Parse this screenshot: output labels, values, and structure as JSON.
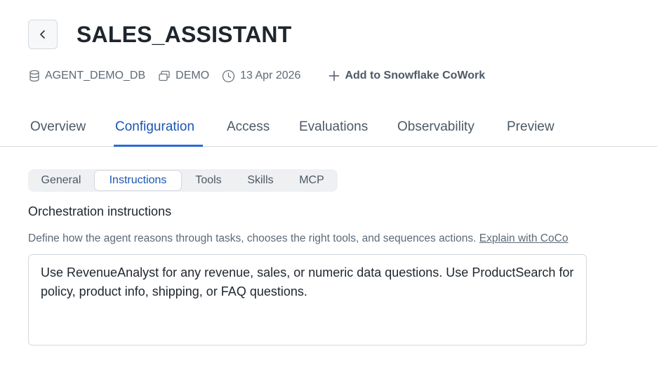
{
  "header": {
    "title": "SALES_ASSISTANT",
    "back_icon": "chevron-left-icon"
  },
  "meta": {
    "database": "AGENT_DEMO_DB",
    "schema": "DEMO",
    "date": "13 Apr 2026",
    "add_label": "Add to Snowflake CoWork"
  },
  "tabs": [
    {
      "label": "Overview"
    },
    {
      "label": "Configuration",
      "active": true
    },
    {
      "label": "Access"
    },
    {
      "label": "Evaluations"
    },
    {
      "label": "Observability"
    },
    {
      "label": "Preview"
    }
  ],
  "subtabs": [
    {
      "label": "General"
    },
    {
      "label": "Instructions",
      "active": true
    },
    {
      "label": "Tools"
    },
    {
      "label": "Skills"
    },
    {
      "label": "MCP"
    }
  ],
  "section": {
    "title": "Orchestration instructions",
    "description": "Define how the agent reasons through tasks, chooses the right tools, and sequences actions.",
    "link": "Explain with CoCo",
    "instructions": "Use RevenueAnalyst for any revenue, sales, or numeric data questions. Use ProductSearch for policy, product info, shipping, or FAQ questions."
  },
  "colors": {
    "accent": "#2b6ad8",
    "active_text": "#1a56b3",
    "muted_text": "#5d6a76",
    "border": "#d5d9de"
  }
}
